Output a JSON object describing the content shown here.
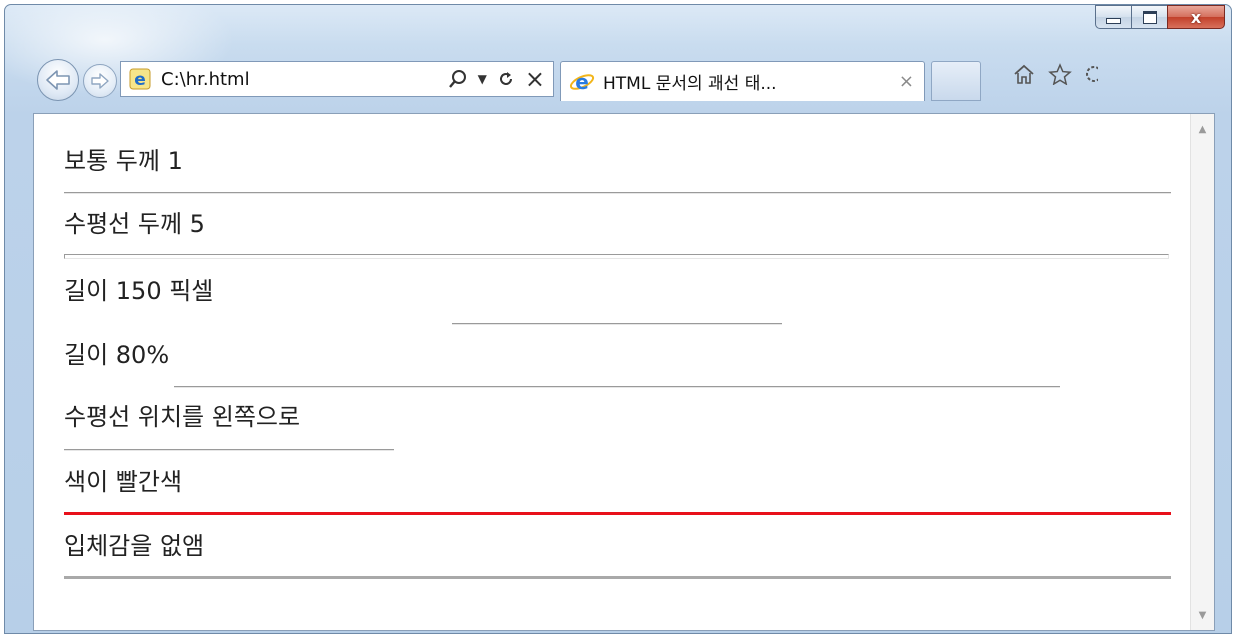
{
  "window": {
    "minimize_icon": "minimize-icon",
    "maximize_icon": "maximize-icon",
    "close_glyph": "x"
  },
  "toolbar": {
    "address": "C:\\hr.html",
    "search_icon": "search-icon",
    "refresh_icon": "refresh-icon",
    "stop_glyph": "×"
  },
  "tab": {
    "title": "HTML 문서의 괘선 태...",
    "close_glyph": "×"
  },
  "content": {
    "lines": [
      {
        "label": "보통 두께 1"
      },
      {
        "label": "수평선 두께 5"
      },
      {
        "label": "길이 150 픽셀"
      },
      {
        "label": "길이 80%"
      },
      {
        "label": "수평선 위치를 왼쪽으로"
      },
      {
        "label": "색이 빨간색"
      },
      {
        "label": "입체감을 없앰"
      }
    ],
    "rule_colors": {
      "default": "#a0a0a0",
      "red": "#e8101a",
      "flat": "#a9a9a9"
    }
  }
}
